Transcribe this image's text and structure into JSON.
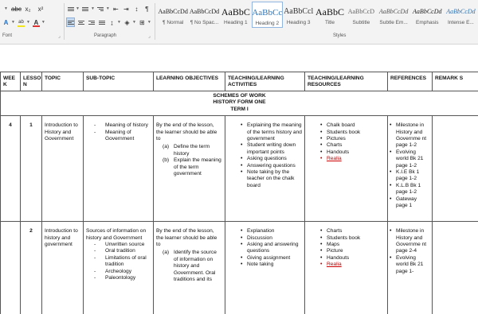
{
  "ribbon": {
    "font_group_label": "Font",
    "paragraph_group_label": "Paragraph",
    "styles_group_label": "Styles",
    "font_buttons": {
      "subscript": "x₂",
      "superscript": "x²",
      "clear_format": "A",
      "text_effects": "A",
      "highlight": "ab",
      "font_color": "A"
    },
    "show_marks": "¶",
    "colors": {
      "accent_selected": "#c5d9ef",
      "font_color_bar": "#e03030",
      "highlight_bar": "#f2e51e",
      "heading_blue": "#2e74b5"
    }
  },
  "styles": [
    {
      "sample": "AaBbCcDd",
      "name": "¶ Normal"
    },
    {
      "sample": "AaBbCcDd",
      "name": "¶ No Spac..."
    },
    {
      "sample": "AaBbC",
      "name": "Heading 1"
    },
    {
      "sample": "AaBbCc",
      "name": "Heading 2"
    },
    {
      "sample": "AaBbCcl",
      "name": "Heading 3"
    },
    {
      "sample": "AaBbC",
      "name": "Title"
    },
    {
      "sample": "AaBbCcD",
      "name": "Subtitle"
    },
    {
      "sample": "AaBbCcDd",
      "name": "Subtle Em..."
    },
    {
      "sample": "AaBbCcDd",
      "name": "Emphasis"
    },
    {
      "sample": "AaBbCcDd",
      "name": "Intense E..."
    }
  ],
  "table": {
    "headers": {
      "week": "WEE K",
      "lesson": "LESSO N",
      "topic": "TOPIC",
      "subtopic": "SUB-TOPIC",
      "objectives": "LEARNING OBJECTIVES",
      "activities": "TEACHING/LEARNING ACTIVITIES",
      "resources": "TEACHING/LEARNING RESOURCES",
      "references": "REFERENCES",
      "remarks": "REMARK S"
    },
    "banner": {
      "line1": "SCHEMES OF WORK",
      "line2": "HISTORY FORM ONE",
      "line3": "TERM I"
    },
    "row1": {
      "week": "4",
      "lesson": "1",
      "topic": "Introduction to History and Government",
      "subtopics": [
        "Meaning of history",
        "Meaning of Government"
      ],
      "objectives_intro": "By the end of the lesson, the learner should be able to",
      "objectives": [
        {
          "mark": "(a)",
          "text": "Define the term history"
        },
        {
          "mark": "(b)",
          "text": "Explain the meaning of the term government"
        }
      ],
      "activities": [
        "Explaining the meaning of the terms history and government",
        "Student writing down important points",
        "Asking questions",
        "Answering questions",
        "Note taking by the teacher on the chalk board"
      ],
      "resources": [
        "Chalk board",
        "Students book",
        "Pictures",
        "Charts",
        "Handouts",
        "Realia"
      ],
      "references": [
        "Milestone in History and Governme nt page 1-2",
        "Evolving world Bk 21 page 1-2",
        "K.I.E Bk 1 page 1-2",
        "K.L.B Bk 1 page 1-2",
        "Gateway page 1"
      ]
    },
    "row2": {
      "lesson": "2",
      "topic": "Introduction to history and government",
      "subtopic_intro": "Sources of information on history and Government",
      "subtopics": [
        "Unwritten source",
        "Oral tradition",
        "Limitations of oral tradition",
        "Archeology",
        "Paleontology"
      ],
      "objectives_intro": "By the end of the lesson, the learner should be able to",
      "objectives": [
        {
          "mark": "(a)",
          "text": "Identify the source of information on history and Government. Oral traditions and its"
        }
      ],
      "activities": [
        "Explanation",
        "Discussion",
        "Asking and answering questions",
        "Giving assignment",
        "Note taking"
      ],
      "resources": [
        "Charts",
        "Students book",
        "Maps",
        "Picture",
        "Handouts",
        "Realia"
      ],
      "references": [
        "Milestone in History and Governme nt page 2-4",
        "Evolving world Bk 21 page 1-"
      ]
    }
  }
}
